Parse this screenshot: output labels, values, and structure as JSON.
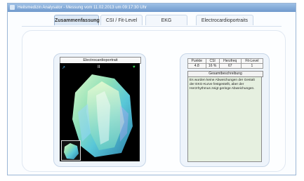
{
  "window": {
    "title": "Heilsmedizin Analysator - Messung vom 11.02.2013 um 09:17:30 Uhr"
  },
  "tabs": [
    {
      "label": "Zusammenfassung",
      "active": true
    },
    {
      "label": "CSI / Fit-Level",
      "active": false
    },
    {
      "label": "EKG",
      "active": false
    },
    {
      "label": "Electrocardioportraits",
      "active": false
    }
  ],
  "ecp": {
    "header": "Electrocardioportrait",
    "left_icon": "cube-icon",
    "center_mark": "II",
    "right_icon": "heart-icon"
  },
  "metrics": {
    "headers": [
      "Punkte",
      "CSI",
      "Herzfreq",
      "Fit-Level"
    ],
    "values": [
      "4.8",
      "16 %",
      "67",
      "1"
    ]
  },
  "description": {
    "header": "Gesamtbeschreibung",
    "text": "Es wurden keine Abweichungen der Gestalt der EKG-Kurve festgestellt, aber der Herzrhythmus zeigt geringe Abweichungen."
  },
  "colors": {
    "accent": "#6f99cc",
    "desc_bg": "#e6f0e0"
  }
}
